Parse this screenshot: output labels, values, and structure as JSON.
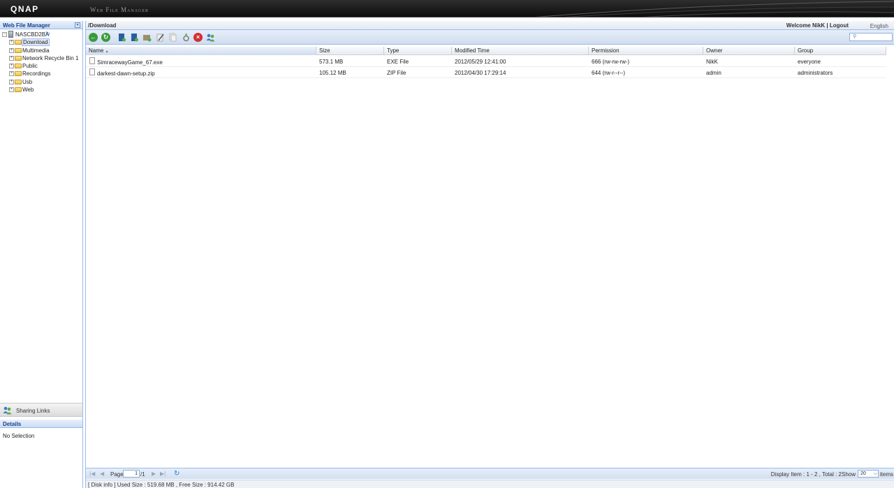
{
  "header": {
    "logo": "QNAP",
    "app_title": "Web File Manager"
  },
  "left_panel": {
    "title": "Web File Manager",
    "tree": {
      "root": "NASCBD2BA",
      "items": [
        {
          "label": "Download",
          "selected": true
        },
        {
          "label": "Multimedia"
        },
        {
          "label": "Network Recycle Bin 1"
        },
        {
          "label": "Public"
        },
        {
          "label": "Recordings"
        },
        {
          "label": "Usb"
        },
        {
          "label": "Web"
        }
      ]
    },
    "sharing_links": "Sharing Links",
    "details_title": "Details",
    "details_body": "No Selection"
  },
  "pathbar": {
    "path": "/Download",
    "welcome": "Welcome NikK | Logout",
    "language": "English"
  },
  "toolbar": {
    "icons": [
      "back-icon",
      "forward-icon",
      "create-folder-icon",
      "upload-icon",
      "share-folder-icon",
      "rename-icon",
      "copy-icon",
      "move-icon",
      "delete-icon",
      "share-link-icon"
    ]
  },
  "grid": {
    "columns": [
      "Name",
      "Size",
      "Type",
      "Modified Time",
      "Permission",
      "Owner",
      "Group"
    ],
    "sorted_indicator": "▲",
    "rows": [
      {
        "name": "SimracewayGame_67.exe",
        "size": "573.1 MB",
        "type": "EXE File",
        "modified": "2012/05/29 12:41:00",
        "permission": "666 (rw-rw-rw-)",
        "owner": "NikK",
        "group": "everyone"
      },
      {
        "name": "darkest-dawn-setup.zip",
        "size": "105.12 MB",
        "type": "ZIP File",
        "modified": "2012/04/30 17:29:14",
        "permission": "644 (rw-r--r--)",
        "owner": "admin",
        "group": "administrators"
      }
    ]
  },
  "pager": {
    "page_label": "Page",
    "page_value": "1",
    "page_total": "/1",
    "display_text": "Display Item : 1 - 2 , Total : 2",
    "show_label": "Show",
    "show_value": "20",
    "items_label": "items"
  },
  "diskinfo": {
    "text": "[ Disk info ] Used Size : 519.68 MB , Free Size : 914.42 GB"
  },
  "colors": {
    "accent": "#99bbe8",
    "title_blue": "#15428b"
  }
}
